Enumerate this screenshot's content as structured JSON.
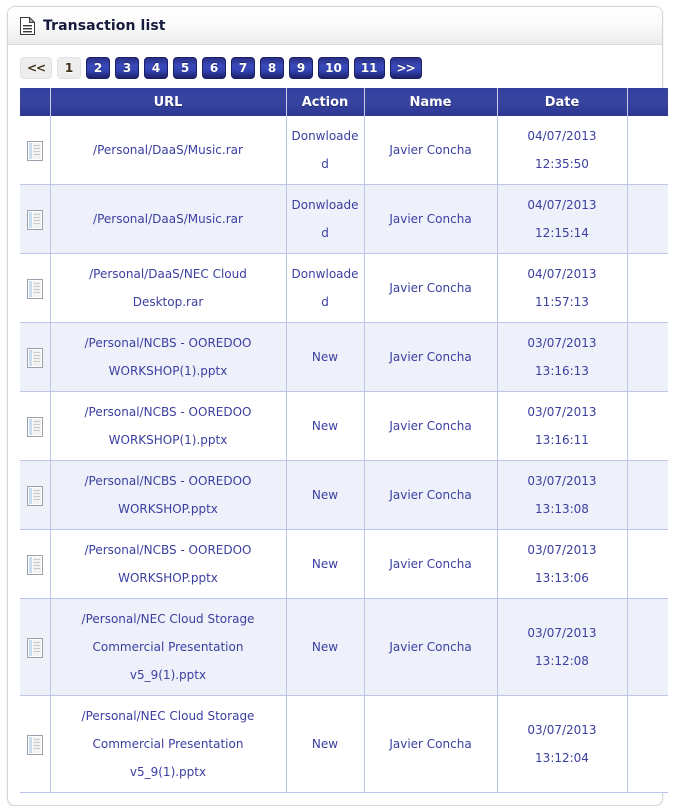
{
  "panel": {
    "title": "Transaction list",
    "title_icon": "document-icon"
  },
  "pagination": {
    "prev_label": "<<",
    "next_label": ">>",
    "current_page": "1",
    "pages": [
      "1",
      "2",
      "3",
      "4",
      "5",
      "6",
      "7",
      "8",
      "9",
      "10",
      "11"
    ]
  },
  "table": {
    "columns": [
      {
        "key": "icon",
        "label": ""
      },
      {
        "key": "url",
        "label": "URL"
      },
      {
        "key": "action",
        "label": "Action"
      },
      {
        "key": "name",
        "label": "Name"
      },
      {
        "key": "date",
        "label": "Date"
      },
      {
        "key": "end",
        "label": ""
      }
    ],
    "row_icon": "file-icon",
    "rows": [
      {
        "url": "/Personal/DaaS/Music.rar",
        "action": "Donwloaded",
        "name": "Javier Concha",
        "date": "04/07/2013 12:35:50"
      },
      {
        "url": "/Personal/DaaS/Music.rar",
        "action": "Donwloaded",
        "name": "Javier Concha",
        "date": "04/07/2013 12:15:14"
      },
      {
        "url": "/Personal/DaaS/NEC Cloud Desktop.rar",
        "action": "Donwloaded",
        "name": "Javier Concha",
        "date": "04/07/2013 11:57:13"
      },
      {
        "url": "/Personal/NCBS - OOREDOO WORKSHOP(1).pptx",
        "action": "New",
        "name": "Javier Concha",
        "date": "03/07/2013 13:16:13"
      },
      {
        "url": "/Personal/NCBS - OOREDOO WORKSHOP(1).pptx",
        "action": "New",
        "name": "Javier Concha",
        "date": "03/07/2013 13:16:11"
      },
      {
        "url": "/Personal/NCBS - OOREDOO WORKSHOP.pptx",
        "action": "New",
        "name": "Javier Concha",
        "date": "03/07/2013 13:13:08"
      },
      {
        "url": "/Personal/NCBS - OOREDOO WORKSHOP.pptx",
        "action": "New",
        "name": "Javier Concha",
        "date": "03/07/2013 13:13:06"
      },
      {
        "url": "/Personal/NEC Cloud Storage Commercial Presentation v5_9(1).pptx",
        "action": "New",
        "name": "Javier Concha",
        "date": "03/07/2013 13:12:08"
      },
      {
        "url": "/Personal/NEC Cloud Storage Commercial Presentation v5_9(1).pptx",
        "action": "New",
        "name": "Javier Concha",
        "date": "03/07/2013 13:12:04"
      }
    ]
  },
  "colors": {
    "header_blue": "#3040a8",
    "link_text": "#3b3fa0",
    "alt_row": "#eef1fa",
    "grid_line": "#bcc6e8",
    "pager_active_bg": "#ededed",
    "title_text": "#161b3d"
  }
}
